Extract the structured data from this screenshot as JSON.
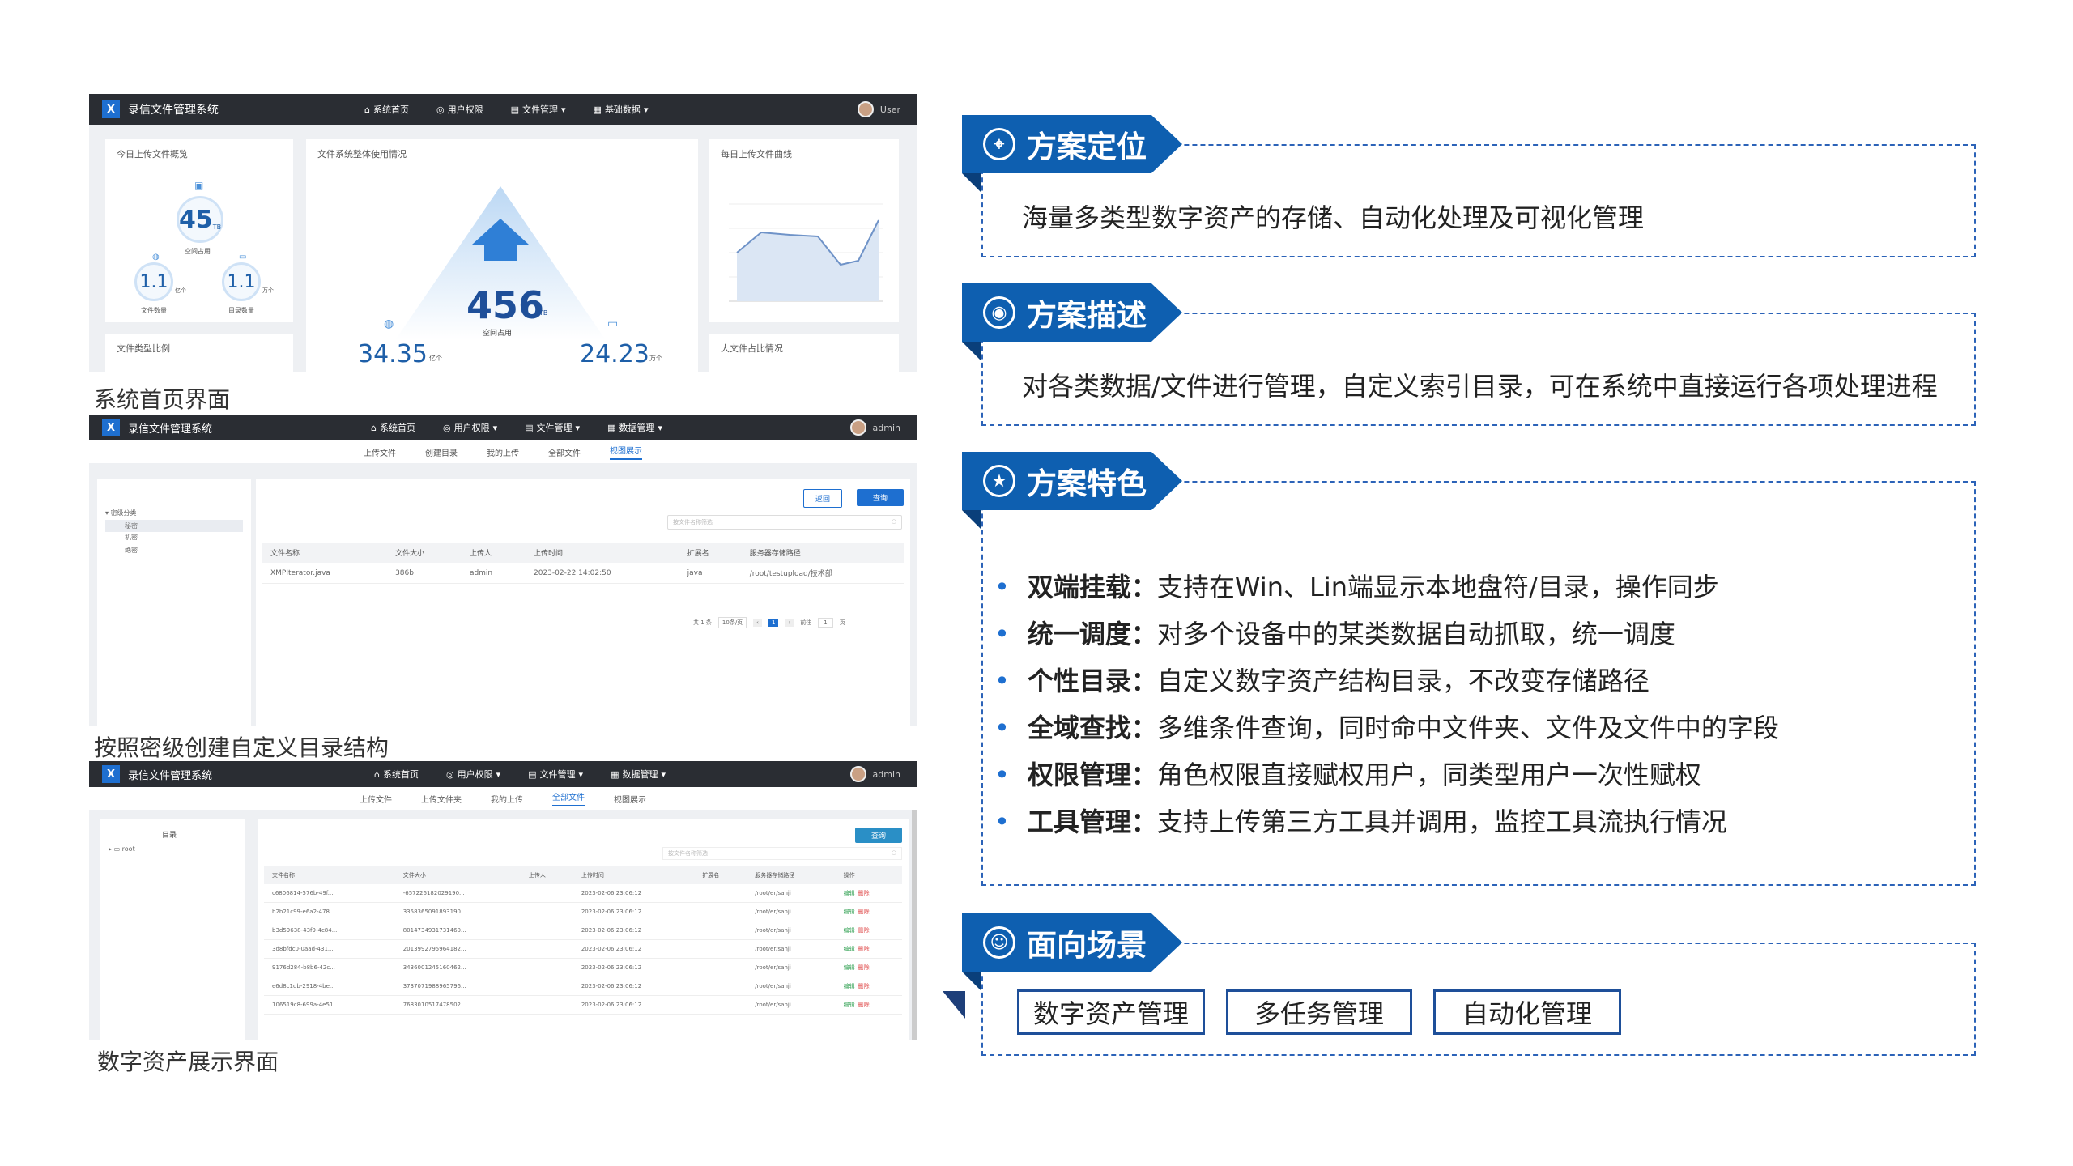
{
  "app_title": "录信文件管理系统",
  "screens": {
    "home": {
      "nav": [
        "系统首页",
        "用户权限",
        "文件管理",
        "基础数据"
      ],
      "user": "User",
      "cards": {
        "today": "今日上传文件概览",
        "usage": "文件系统整体使用情况",
        "daily": "每日上传文件曲线",
        "ratio": "文件类型比例",
        "size": "大文件占比情况"
      },
      "today_space": "45",
      "today_space_unit": "TB",
      "today_space_label": "空间占用",
      "today_files": "1.1",
      "today_files_unit": "亿个",
      "today_files_label": "文件数量",
      "today_dirs": "1.1",
      "today_dirs_unit": "万个",
      "today_dirs_label": "目录数量",
      "total_space": "456",
      "total_space_unit": "TB",
      "total_space_label": "空间占用",
      "total_files": "34.35",
      "total_files_unit": "亿个",
      "total_dirs": "24.23",
      "total_dirs_unit": "万个",
      "caption": "系统首页界面"
    },
    "catalog": {
      "nav": [
        "系统首页",
        "用户权限",
        "文件管理",
        "数据管理"
      ],
      "user": "admin",
      "subtabs": [
        "上传文件",
        "创建目录",
        "我的上传",
        "全部文件",
        "视图展示"
      ],
      "active_tab": "视图展示",
      "tree": [
        "密级分类",
        "秘密",
        "机密",
        "绝密"
      ],
      "btn_reset": "返回",
      "btn_query": "查询",
      "search_placeholder": "按文件名称筛选",
      "columns": [
        "文件名称",
        "文件大小",
        "上传人",
        "上传时间",
        "扩展名",
        "服务器存储路径"
      ],
      "rows": [
        [
          "XMPIterator.java",
          "386b",
          "admin",
          "2023-02-22 14:02:50",
          "java",
          "/root/testupload/技术部"
        ]
      ],
      "pager": "共 1 条",
      "pager_size": "10条/页",
      "pager_page": "1",
      "pager_goto": "前往",
      "pager_goto_page": "1",
      "pager_goto_unit": "页",
      "caption": "按照密级创建自定义目录结构"
    },
    "assets": {
      "nav": [
        "系统首页",
        "用户权限",
        "文件管理",
        "数据管理"
      ],
      "user": "admin",
      "subtabs": [
        "上传文件",
        "上传文件夹",
        "我的上传",
        "全部文件",
        "视图展示"
      ],
      "active_tab": "全部文件",
      "tree_title": "目录",
      "tree_root": "root",
      "btn_query": "查询",
      "search_placeholder": "按文件名称筛选",
      "columns": [
        "文件名称",
        "文件大小",
        "上传人",
        "上传时间",
        "扩展名",
        "服务器存储路径",
        "操作"
      ],
      "rows": [
        [
          "c6806814-576b-49f...",
          "-657226182029190...",
          "",
          "2023-02-06 23:06:12",
          "",
          "/root/er/sanji"
        ],
        [
          "b2b21c99-e6a2-478...",
          "3358365091893190...",
          "",
          "2023-02-06 23:06:12",
          "",
          "/root/er/sanji"
        ],
        [
          "b3d59638-43f9-4c84...",
          "8014734931731460...",
          "",
          "2023-02-06 23:06:12",
          "",
          "/root/er/sanji"
        ],
        [
          "3d8bfdc0-0aad-431...",
          "2013992795964182...",
          "",
          "2023-02-06 23:06:12",
          "",
          "/root/er/sanji"
        ],
        [
          "9176d284-b8b6-42c...",
          "3436001245160462...",
          "",
          "2023-02-06 23:06:12",
          "",
          "/root/er/sanji"
        ],
        [
          "e6d8c1db-2918-4be...",
          "3737071988965796...",
          "",
          "2023-02-06 23:06:12",
          "",
          "/root/er/sanji"
        ],
        [
          "106519c8-699a-4e51...",
          "7683010517478502...",
          "",
          "2023-02-06 23:06:12",
          "",
          "/root/er/sanji"
        ]
      ],
      "op_edit": "编辑",
      "op_delete": "删除",
      "caption": "数字资产展示界面"
    }
  },
  "sections": {
    "positioning": {
      "title": "方案定位",
      "text": "海量多类型数字资产的存储、自动化处理及可视化管理"
    },
    "description": {
      "title": "方案描述",
      "text": "对各类数据/文件进行管理，自定义索引目录，可在系统中直接运行各项处理进程"
    },
    "features": {
      "title": "方案特色",
      "items": [
        {
          "k": "双端挂载：",
          "v": "支持在Win、Lin端显示本地盘符/目录，操作同步"
        },
        {
          "k": "统一调度：",
          "v": "对多个设备中的某类数据自动抓取，统一调度"
        },
        {
          "k": "个性目录：",
          "v": "自定义数字资产结构目录，不改变存储路径"
        },
        {
          "k": "全域查找：",
          "v": "多维条件查询，同时命中文件夹、文件及文件中的字段"
        },
        {
          "k": "权限管理：",
          "v": "角色权限直接赋权用户，同类型用户一次性赋权"
        },
        {
          "k": "工具管理：",
          "v": "支持上传第三方工具并调用，监控工具流执行情况"
        }
      ]
    },
    "scenarios": {
      "title": "面向场景",
      "items": [
        "数字资产管理",
        "多任务管理",
        "自动化管理"
      ]
    }
  },
  "colors": {
    "brand": "#0e5fb0",
    "dark_bar": "#2a2d33",
    "dashed": "#2c63b8"
  }
}
